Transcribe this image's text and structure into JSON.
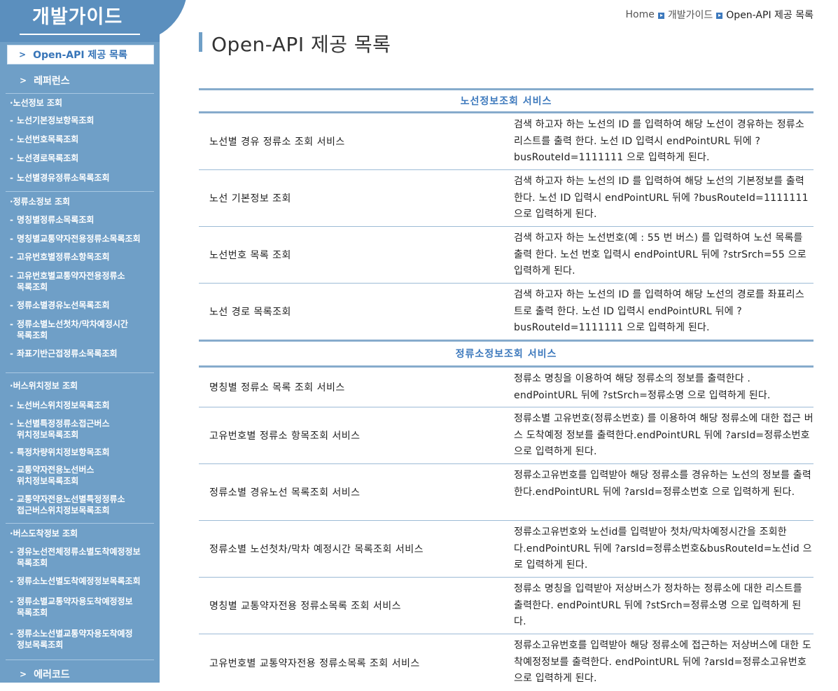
{
  "sidebar": {
    "title": "개발가이드",
    "current": "Open-API 제공 목록",
    "reference": "레퍼런스",
    "groups": [
      {
        "label": "노선정보 조회",
        "items": [
          "노선기본정보항목조회",
          "노선번호목록조회",
          "노선경로목록조회",
          "노선별경유정류소목록조회"
        ]
      },
      {
        "label": "정류소정보 조회",
        "items": [
          "명칭별정류소목록조회",
          "명칭별교통약자전용정류소목록조회",
          "고유번호별정류소항목조회",
          "고유번호별교통약자전용정류소\n목록조회",
          "정류소별경유노선목록조회",
          "정류소별노선첫차/막차예정시간\n목록조회",
          "좌표기반근접정류소목록조회"
        ]
      },
      {
        "label": "버스위치정보 조회",
        "items": [
          "노선버스위치정보목록조회",
          "노선별특정정류소접근버스\n위치정보목록조회",
          "특정차량위치정보항목조회",
          "교통약자전용노선버스\n위치정보목록조회",
          "교통약자전용노선별특정정류소\n접근버스위치정보목록조회"
        ]
      },
      {
        "label": "버스도착정보 조회",
        "items": [
          "경유노선전체정류소별도착예정정보\n목록조회",
          "정류소노선별도착예정정보목록조회",
          "정류소별교통약자용도착예정정보\n목록조회",
          "정류소노선별교통약자용도착예정\n정보목록조회"
        ]
      }
    ],
    "error_code": "에러코드"
  },
  "breadcrumb": {
    "home": "Home",
    "level1": "개발가이드",
    "current": "Open-API 제공 목록"
  },
  "page_title": "Open-API 제공 목록",
  "sections": [
    {
      "title": "노선정보조회 서비스",
      "rows": [
        {
          "name": "노선별 경유 정류소 조회 서비스",
          "desc": "검색 하고자 하는 노선의 ID 를 입력하여 해당 노선이 경유하는 정류소 리스트를 출력 한다. 노선 ID 입력시 endPointURL 뒤에 ?busRouteId=1111111 으로 입력하게 된다."
        },
        {
          "name": "노선 기본정보 조회",
          "desc": "검색 하고자 하는 노선의 ID 를 입력하여 해당 노선의 기본정보를 출력 한다. 노선 ID 입력시 endPointURL 뒤에 ?busRouteId=1111111 으로 입력하게 된다."
        },
        {
          "name": "노선번호 목록 조회",
          "desc": "검색 하고자 하는 노선번호(예 : 55 번 버스) 를 입력하여 노선 목록를 출력 한다. 노선 번호 입력시 endPointURL 뒤에 ?strSrch=55 으로 입력하게 된다."
        },
        {
          "name": "노선 경로 목록조회",
          "desc": "검색 하고자 하는 노선의 ID 를 입력하여 해당 노선의 경로를 좌표리스트로 출력 한다. 노선 ID 입력시 endPointURL 뒤에 ?busRouteId=1111111 으로 입력하게 된다."
        }
      ]
    },
    {
      "title": "정류소정보조회 서비스",
      "rows": [
        {
          "name": "명칭별 정류소 목록 조회 서비스",
          "desc": "정류소 명칭을 이용하여 해당 정류소의 정보를 출력한다 . endPointURL 뒤에 ?stSrch=정류소명 으로 입력하게 된다."
        },
        {
          "name": "고유번호별 정류소 항목조회 서비스",
          "desc": "정류소별 고유번호(정류소번호) 를 이용하여 해당 정류소에 대한 접근 버스 도착예정 정보를 출력한다.endPointURL 뒤에 ?arsId=정류소번호 으로 입력하게 된다."
        },
        {
          "name": "정류소별 경유노선 목록조회 서비스",
          "desc": "정류소고유번호를 입력받아 해당 정류소를 경유하는 노선의 정보를 출력한다.endPointURL 뒤에 ?arsId=정류소번호 으로 입력하게 된다."
        },
        {
          "name": "정류소별 노선첫차/막차 예정시간 목록조회 서비스",
          "desc": "정류소고유번호와 노선id를 입력받아 첫차/막차예정시간을 조회한다.endPointURL 뒤에 ?arsId=정류소번호&busRouteId=노선id 으로 입력하게 된다."
        },
        {
          "name": "명칭별 교통약자전용 정류소목록 조회 서비스",
          "desc": "정류소 명칭을 입력받아 저상버스가 정차하는 정류소에 대한 리스트를 출력한다. endPointURL 뒤에 ?stSrch=정류소명 으로 입력하게 된다."
        },
        {
          "name": "고유번호별 교통약자전용 정류소목록 조회 서비스",
          "desc": "정류소고유번호를 입력받아 해당 정류소에 접근하는 저상버스에 대한 도착예정정보를 출력한다. endPointURL 뒤에 ?arsId=정류소고유번호 으로 입력하게 된다."
        }
      ]
    }
  ]
}
